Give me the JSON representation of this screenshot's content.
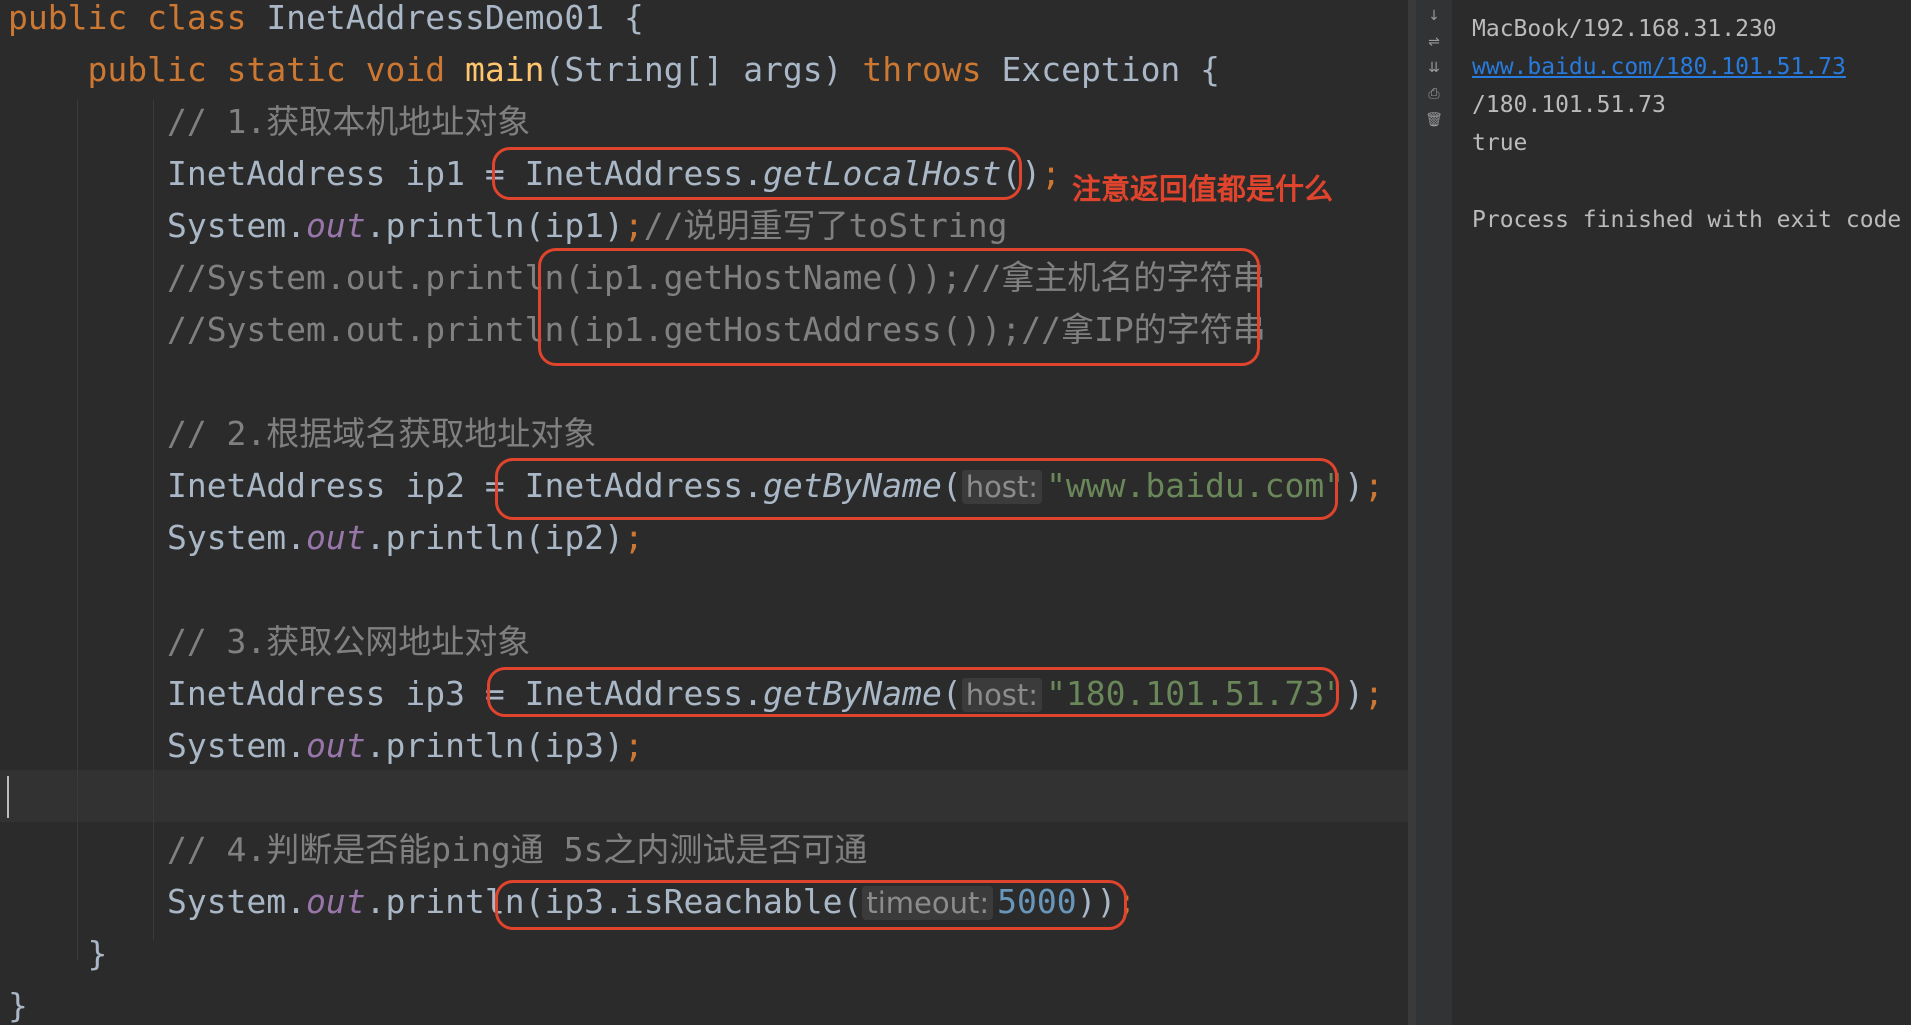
{
  "editor": {
    "class_decl": {
      "kw_public": "public",
      "kw_class": "class",
      "name": "InetAddressDemo01",
      "brace": " {"
    },
    "main_decl": {
      "kw_public": "public",
      "kw_static": "static",
      "kw_void": "void",
      "name": "main",
      "params": "(String[] args) ",
      "kw_throws": "throws",
      "exception": " Exception {"
    },
    "comment1": "// 1.获取本机地址对象",
    "line_ip1": {
      "decl": "InetAddress ip1 = ",
      "cls": "InetAddress.",
      "method": "getLocalHost",
      "call": "()",
      "semi": ";"
    },
    "line_print1": {
      "sys": "System.",
      "out": "out",
      "rest": ".println(ip1)",
      "semi": ";",
      "comment": "//说明重写了toString"
    },
    "comment_hostname": "//System.out.println(ip1.getHostName());//拿主机名的字符串",
    "comment_hostaddr": "//System.out.println(ip1.getHostAddress());//拿IP的字符串",
    "comment2": "// 2.根据域名获取地址对象",
    "line_ip2": {
      "decl": "InetAddress ip2 = ",
      "cls": "InetAddress.",
      "method": "getByName",
      "open": "(",
      "hint": "host:",
      "arg": "\"www.baidu.com\"",
      "close": ")",
      "semi": ";"
    },
    "line_print2": {
      "sys": "System.",
      "out": "out",
      "rest": ".println(ip2)",
      "semi": ";"
    },
    "comment3": "// 3.获取公网地址对象",
    "line_ip3": {
      "decl": "InetAddress ip3 = ",
      "cls": "InetAddress.",
      "method": "getByName",
      "open": "(",
      "hint": "host:",
      "arg": "\"180.101.51.73\"",
      "close": ")",
      "semi": ";"
    },
    "line_print3": {
      "sys": "System.",
      "out": "out",
      "rest": ".println(ip3)",
      "semi": ";"
    },
    "comment4": "// 4.判断是否能ping通 5s之内测试是否可通",
    "line_reach": {
      "sys": "System.",
      "out": "out",
      "rest": ".println(ip3.isReachable(",
      "hint": "timeout:",
      "arg": "5000",
      "close": "))",
      "semi": ";"
    },
    "close_method": "}",
    "close_class": "}"
  },
  "annotation": "注意返回值都是什么",
  "toolstrip": {
    "icons": [
      "scroll-to-end-icon",
      "soft-wrap-icon",
      "scroll-down-icon",
      "print-icon",
      "trash-icon"
    ],
    "glyphs": [
      "↓",
      "⇌",
      "⇊",
      "⎙",
      "🗑"
    ]
  },
  "console": {
    "lines": [
      "MacBook/192.168.31.230",
      "www.baidu.com/180.101.51.73",
      "/180.101.51.73",
      "true",
      "",
      "Process finished with exit code"
    ]
  },
  "colors": {
    "background": "#2b2b2b",
    "keyword": "#cc7832",
    "method_decl": "#ffc66d",
    "field": "#9876aa",
    "string": "#6a8759",
    "number": "#6897bb",
    "comment": "#808080",
    "annotation": "#e0442c",
    "link": "#287bde"
  }
}
